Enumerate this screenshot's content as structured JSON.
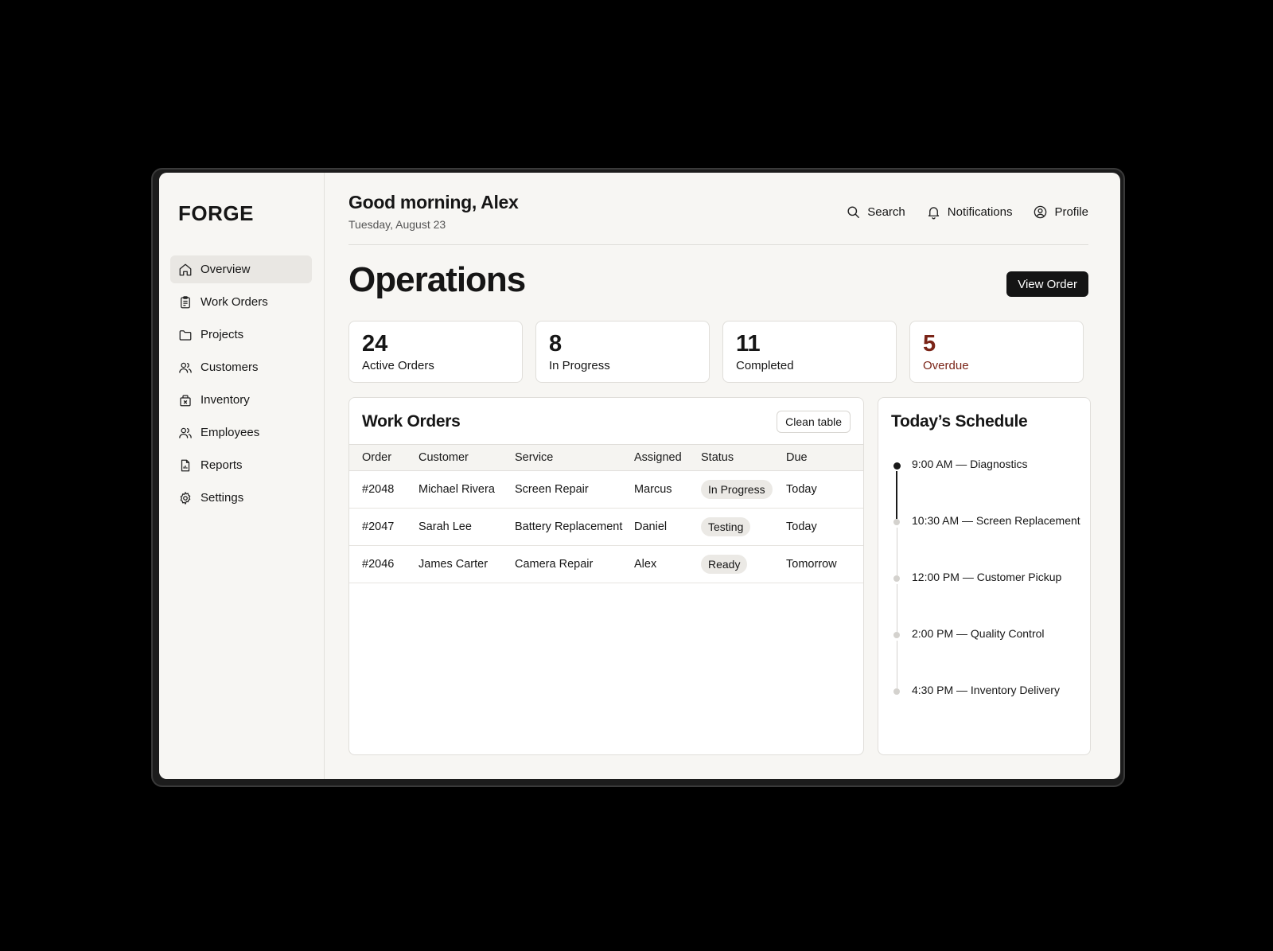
{
  "app": {
    "brand": "FORGE"
  },
  "sidebar": {
    "items": [
      {
        "label": "Overview",
        "icon": "home-icon",
        "active": true
      },
      {
        "label": "Work Orders",
        "icon": "clipboard-icon"
      },
      {
        "label": "Projects",
        "icon": "folder-icon"
      },
      {
        "label": "Customers",
        "icon": "users-icon"
      },
      {
        "label": "Inventory",
        "icon": "box-icon"
      },
      {
        "label": "Employees",
        "icon": "users-icon"
      },
      {
        "label": "Reports",
        "icon": "report-icon"
      },
      {
        "label": "Settings",
        "icon": "gear-icon"
      }
    ]
  },
  "header": {
    "greeting": "Good morning, Alex",
    "date": "Tuesday, August 23",
    "search_label": "Search",
    "notifications_label": "Notifications",
    "profile_label": "Profile"
  },
  "page": {
    "title": "Operations",
    "primary_action": "View Order"
  },
  "stats": [
    {
      "value": "24",
      "label": "Active Orders"
    },
    {
      "value": "8",
      "label": "In Progress"
    },
    {
      "value": "11",
      "label": "Completed"
    },
    {
      "value": "5",
      "label": "Overdue",
      "color": "#7a2417"
    }
  ],
  "work_orders": {
    "title": "Work Orders",
    "clean_label": "Clean table",
    "columns": [
      "Order",
      "Customer",
      "Service",
      "Assigned",
      "Status",
      "Due"
    ],
    "rows": [
      {
        "order": "#2048",
        "customer": "Michael Rivera",
        "service": "Screen Repair",
        "assigned": "Marcus",
        "status": "In Progress",
        "due": "Today"
      },
      {
        "order": "#2047",
        "customer": "Sarah Lee",
        "service": "Battery Replacement",
        "assigned": "Daniel",
        "status": "Testing",
        "due": "Today"
      },
      {
        "order": "#2046",
        "customer": "James Carter",
        "service": "Camera Repair",
        "assigned": "Alex",
        "status": "Ready",
        "due": "Tomorrow"
      }
    ]
  },
  "schedule": {
    "title": "Today’s Schedule",
    "items": [
      "9:00 AM — Diagnostics",
      "10:30 AM — Screen Replacement",
      "12:00 PM — Customer Pickup",
      "2:00 PM — Quality Control",
      "4:30 PM — Inventory Delivery"
    ]
  }
}
